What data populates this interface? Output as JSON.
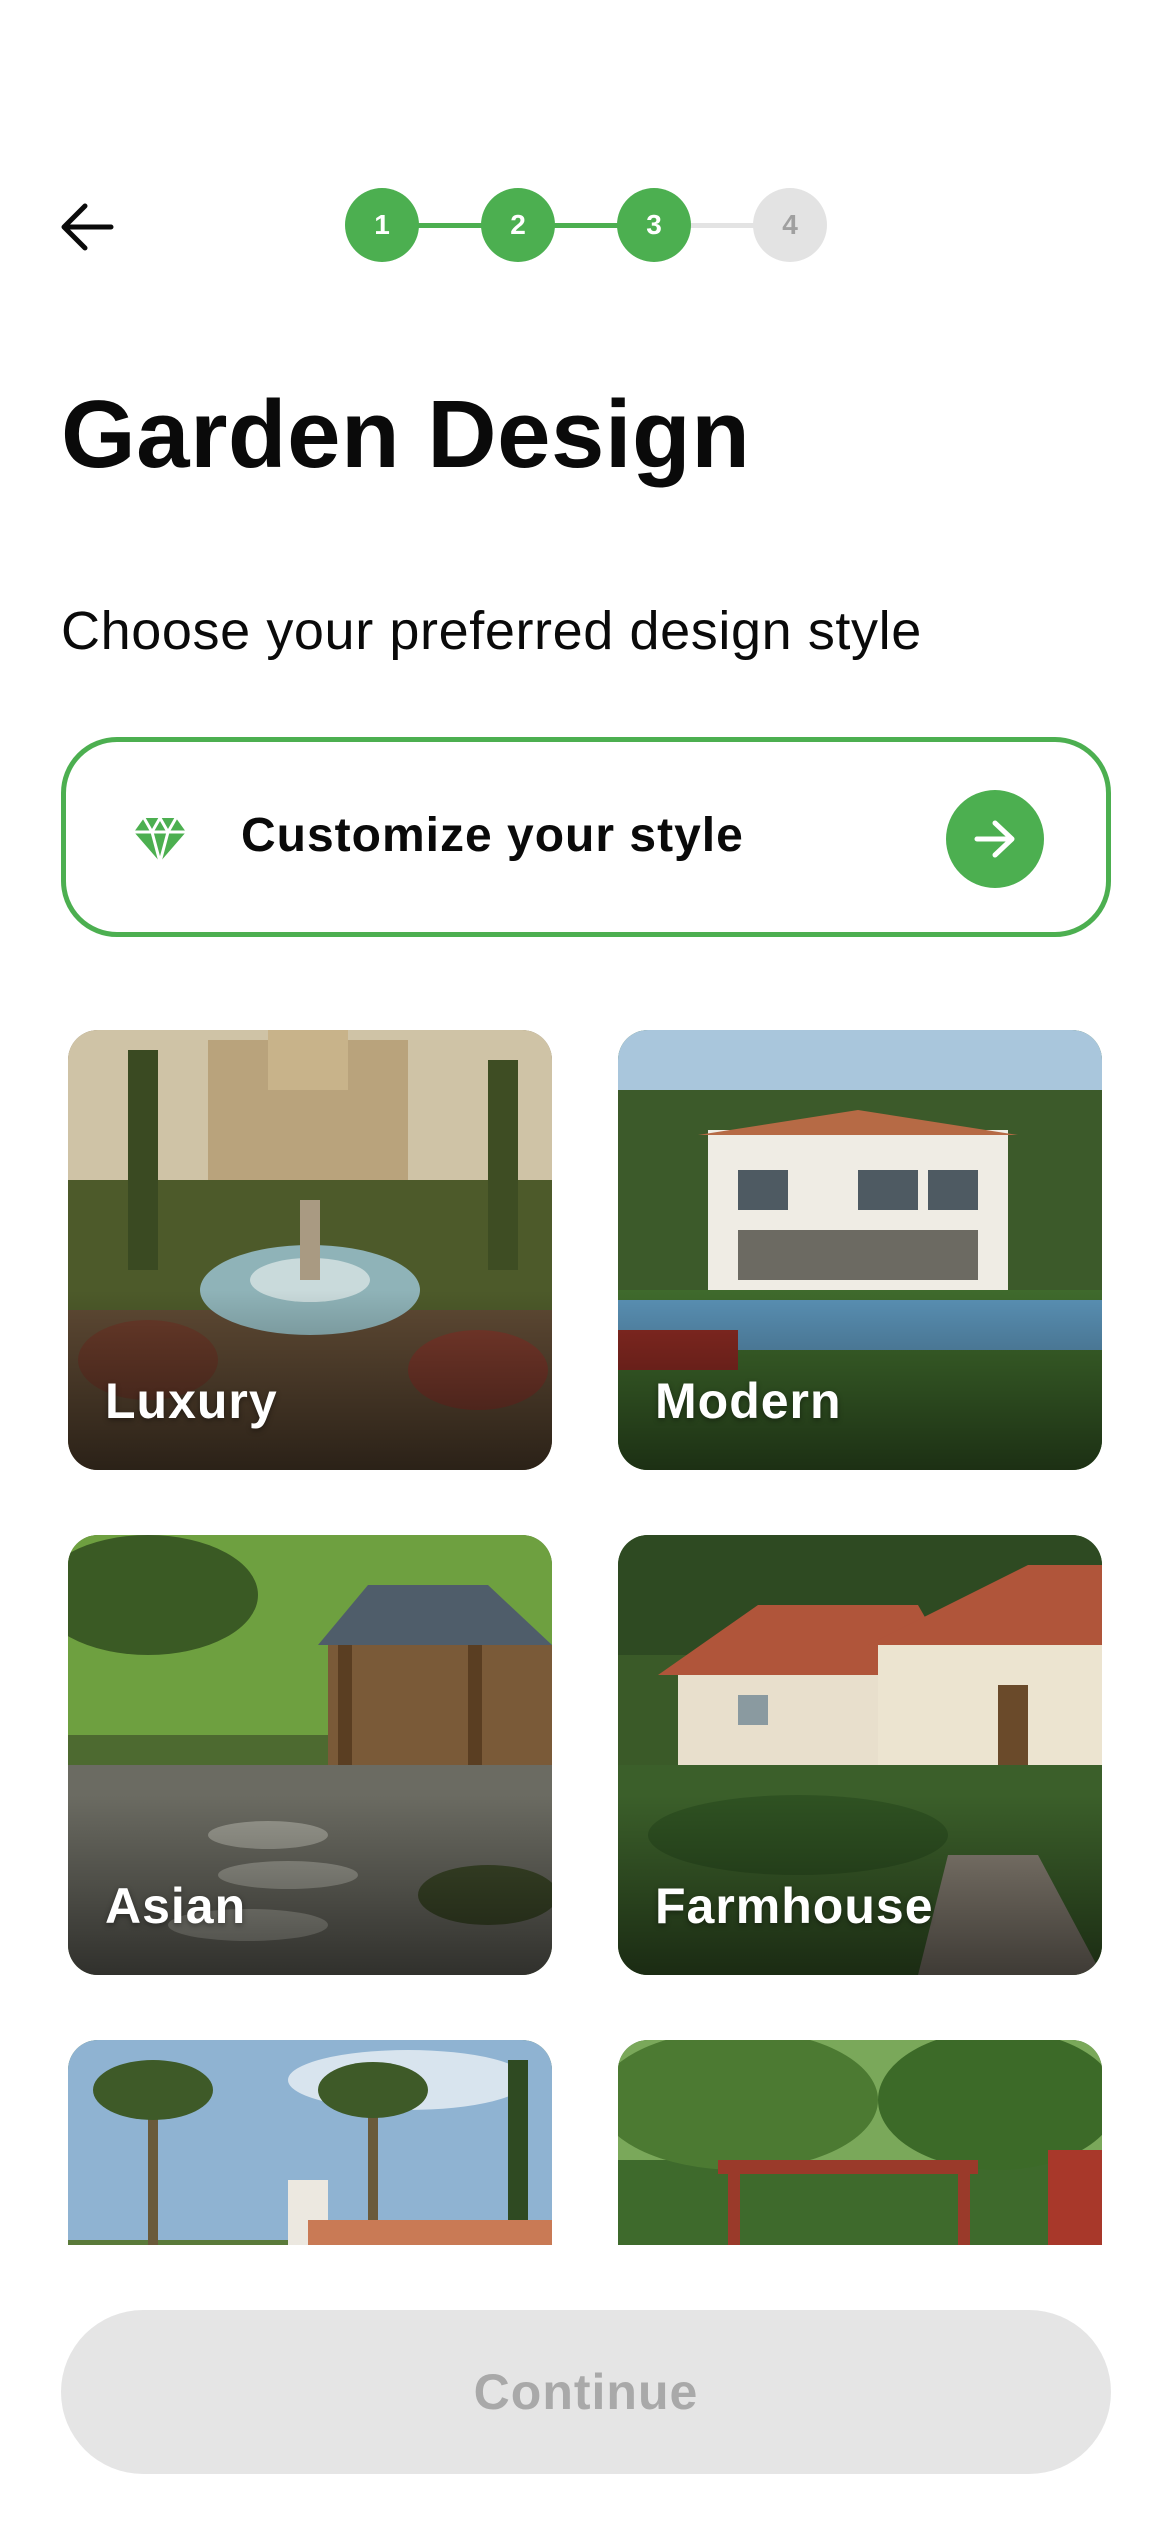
{
  "colors": {
    "accent": "#4caf50",
    "step_inactive": "#e3e3e3",
    "step_inactive_text": "#a0a0a0",
    "button_disabled_bg": "#e5e5e5",
    "button_disabled_text": "#a9a9a9"
  },
  "nav": {
    "back_icon": "arrow-left-icon"
  },
  "stepper": {
    "steps": [
      {
        "number": "1",
        "state": "completed"
      },
      {
        "number": "2",
        "state": "completed"
      },
      {
        "number": "3",
        "state": "current"
      },
      {
        "number": "4",
        "state": "upcoming"
      }
    ]
  },
  "header": {
    "title": "Garden Design",
    "subtitle": "Choose your preferred design style"
  },
  "customize": {
    "icon": "gem-icon",
    "label": "Customize your style",
    "arrow_icon": "arrow-right-icon"
  },
  "styles": [
    {
      "label": "Luxury"
    },
    {
      "label": "Modern"
    },
    {
      "label": "Asian"
    },
    {
      "label": "Farmhouse"
    },
    {
      "label": ""
    },
    {
      "label": ""
    }
  ],
  "footer": {
    "continue_label": "Continue"
  }
}
